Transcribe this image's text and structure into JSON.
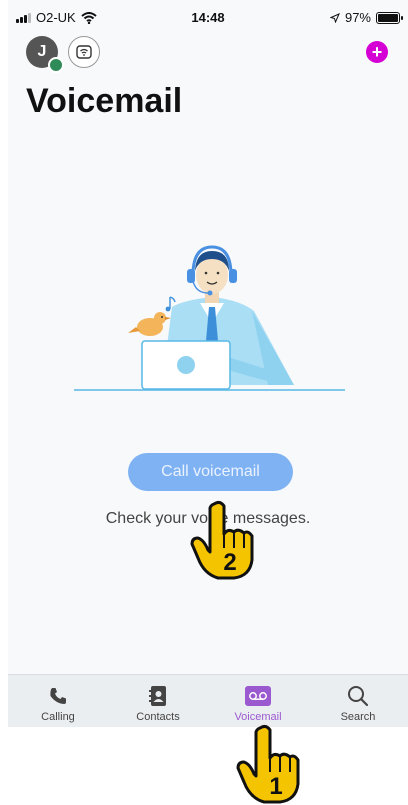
{
  "status_bar": {
    "carrier": "O2-UK",
    "time": "14:48",
    "battery": "97%"
  },
  "header": {
    "avatar_initial": "J",
    "title": "Voicemail"
  },
  "main": {
    "call_button_label": "Call voicemail",
    "subtitle": "Check your voice messages."
  },
  "tabbar": {
    "tabs": [
      {
        "label": "Calling",
        "icon": "phone-icon"
      },
      {
        "label": "Contacts",
        "icon": "contacts-icon"
      },
      {
        "label": "Voicemail",
        "icon": "voicemail-icon"
      },
      {
        "label": "Search",
        "icon": "search-icon"
      }
    ],
    "active": "Voicemail"
  },
  "annotations": {
    "step1": "1",
    "step2": "2"
  },
  "colors": {
    "accent": "#9b59d0",
    "button": "#7fb2f3",
    "add": "#d400d4",
    "hand": "#f5c400"
  }
}
